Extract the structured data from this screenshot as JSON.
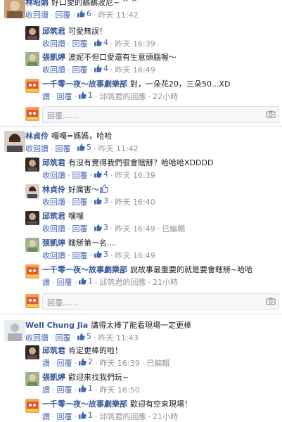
{
  "labels": {
    "reply": "回覆",
    "unlike": "收回讚",
    "like": "讚",
    "reply_placeholder": "回覆……",
    "edited": "已編輯",
    "reply_of": "邱筑君的回應"
  },
  "threads": [
    {
      "name": "林昭娟",
      "text": "好口愛的鵝鵝波尼~ ^ ^",
      "like_action": "收回讚",
      "likes": "6",
      "time": "昨天 11:42",
      "replies": [
        {
          "name": "邱筑君",
          "text": "可愛無誤！",
          "like_action": "收回讚",
          "likes": "4",
          "time": "昨天 16:39"
        },
        {
          "name": "張凱婷",
          "text": "波妮不但口愛還有生意頭腦喔～",
          "like_action": "收回讚",
          "likes": "4",
          "time": "昨天 16:49"
        },
        {
          "name": "一千零一夜～故事劇樂部",
          "text": "對，一朵花20，三朵50...XD",
          "like_action": "讚",
          "likes": "1",
          "reply_to": "邱筑君的回應",
          "time": "22小時"
        }
      ]
    },
    {
      "name": "林貞伶",
      "text": "嘎嘎=媽媽，哈哈",
      "like_action": "收回讚",
      "likes": "5",
      "time": "昨天 11:42",
      "replies": [
        {
          "name": "邱筑君",
          "text": "有沒有覺得我們很會瞎掰？哈哈哈XDDDD",
          "like_action": "收回讚",
          "likes": "4",
          "time": "昨天 16:39"
        },
        {
          "name": "林貞伶",
          "text": "好厲害～",
          "like_action": "收回讚",
          "likes": "3",
          "time": "昨天 16:40",
          "inline_like": true
        },
        {
          "name": "邱筑君",
          "text": "嘿嘿",
          "like_action": "收回讚",
          "likes": "3",
          "time": "昨天 16:49",
          "edited": "已編輯"
        },
        {
          "name": "張凱婷",
          "text": "瞎掰第一名....",
          "like_action": "收回讚",
          "likes": "3",
          "time": "昨天 16:49"
        },
        {
          "name": "一千零一夜～故事劇樂部",
          "text": "說故事最重要的就是要會瞎掰~哈哈",
          "like_action": "讚",
          "likes": "1",
          "reply_to": "邱筑君的回應",
          "time": "21小時"
        }
      ]
    },
    {
      "name": "Well Chung Jia",
      "text": "講得太棒了能看現場一定更棒",
      "like_action": "收回讚",
      "likes": "5",
      "time": "昨天 11:43",
      "replies": [
        {
          "name": "邱筑君",
          "text": "肯定更棒的啦！",
          "like_action": "讚",
          "likes": "2",
          "time": "昨天 16:39",
          "edited": "已編輯"
        },
        {
          "name": "張凱婷",
          "text": "歡迎來找我們玩~",
          "like_action": "讚",
          "likes": "1",
          "time": "昨天 16:50"
        },
        {
          "name": "一千零一夜～故事劇樂部",
          "text": "歡迎有空來現場！",
          "like_action": "讚",
          "likes": "1",
          "reply_to": "邱筑君的回應",
          "time": "21小時"
        }
      ]
    }
  ]
}
